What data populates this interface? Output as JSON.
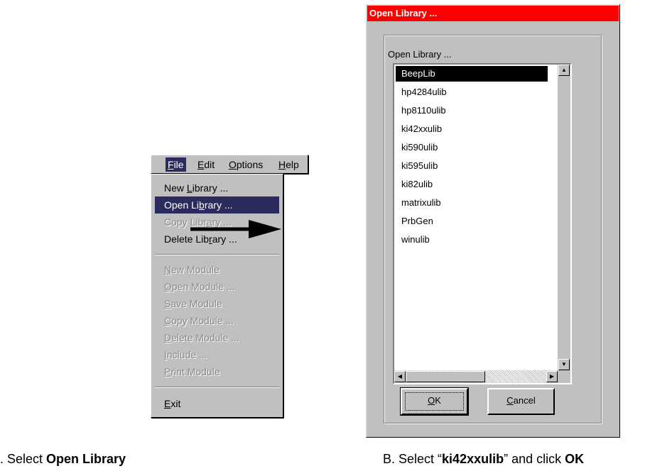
{
  "menubar": {
    "items": [
      {
        "label": "File",
        "mnemonic": "F",
        "rest": "ile"
      },
      {
        "label": "Edit",
        "mnemonic": "E",
        "rest": "dit"
      },
      {
        "label": "Options",
        "mnemonic": "O",
        "rest": "ptions"
      },
      {
        "label": "Help",
        "mnemonic": "H",
        "rest": "elp"
      }
    ]
  },
  "file_menu": {
    "items": [
      {
        "pre": "New ",
        "mn": "L",
        "post": "ibrary ...",
        "enabled": true
      },
      {
        "pre": "Open Li",
        "mn": "b",
        "post": "rary ...",
        "enabled": true,
        "selected": true
      },
      {
        "pre": "Copy Libr",
        "mn": "a",
        "post": "ry ...",
        "enabled": false
      },
      {
        "pre": "Delete Lib",
        "mn": "r",
        "post": "ary ...",
        "enabled": true
      },
      {
        "pre": "",
        "mn": "N",
        "post": "ew Module",
        "enabled": false
      },
      {
        "pre": "",
        "mn": "O",
        "post": "pen Module ...",
        "enabled": false
      },
      {
        "pre": "",
        "mn": "S",
        "post": "ave Module",
        "enabled": false
      },
      {
        "pre": "",
        "mn": "C",
        "post": "opy Module ...",
        "enabled": false
      },
      {
        "pre": "",
        "mn": "D",
        "post": "elete Module ...",
        "enabled": false
      },
      {
        "pre": "",
        "mn": "I",
        "post": "nclude ...",
        "enabled": false
      },
      {
        "pre": "",
        "mn": "P",
        "post": "rint Module",
        "enabled": false
      },
      {
        "pre": "",
        "mn": "E",
        "post": "xit",
        "enabled": true
      }
    ]
  },
  "dialog": {
    "title": "Open Library ...",
    "group_label": "Open Library ...",
    "list": [
      "BeepLib",
      "hp4284ulib",
      "hp8110ulib",
      "ki42xxulib",
      "ki590ulib",
      "ki595ulib",
      "ki82ulib",
      "matrixulib",
      "PrbGen",
      "winulib"
    ],
    "selected_index": 0,
    "ok": {
      "mn": "O",
      "post": "K"
    },
    "cancel": {
      "mn": "C",
      "post": "ancel"
    }
  },
  "captions": {
    "a_prefix": ". Select ",
    "a_bold": "Open Library",
    "b_prefix": "B. Select “",
    "b_bold1": "ki42xxulib",
    "b_mid": "” and click ",
    "b_bold2": "OK"
  }
}
